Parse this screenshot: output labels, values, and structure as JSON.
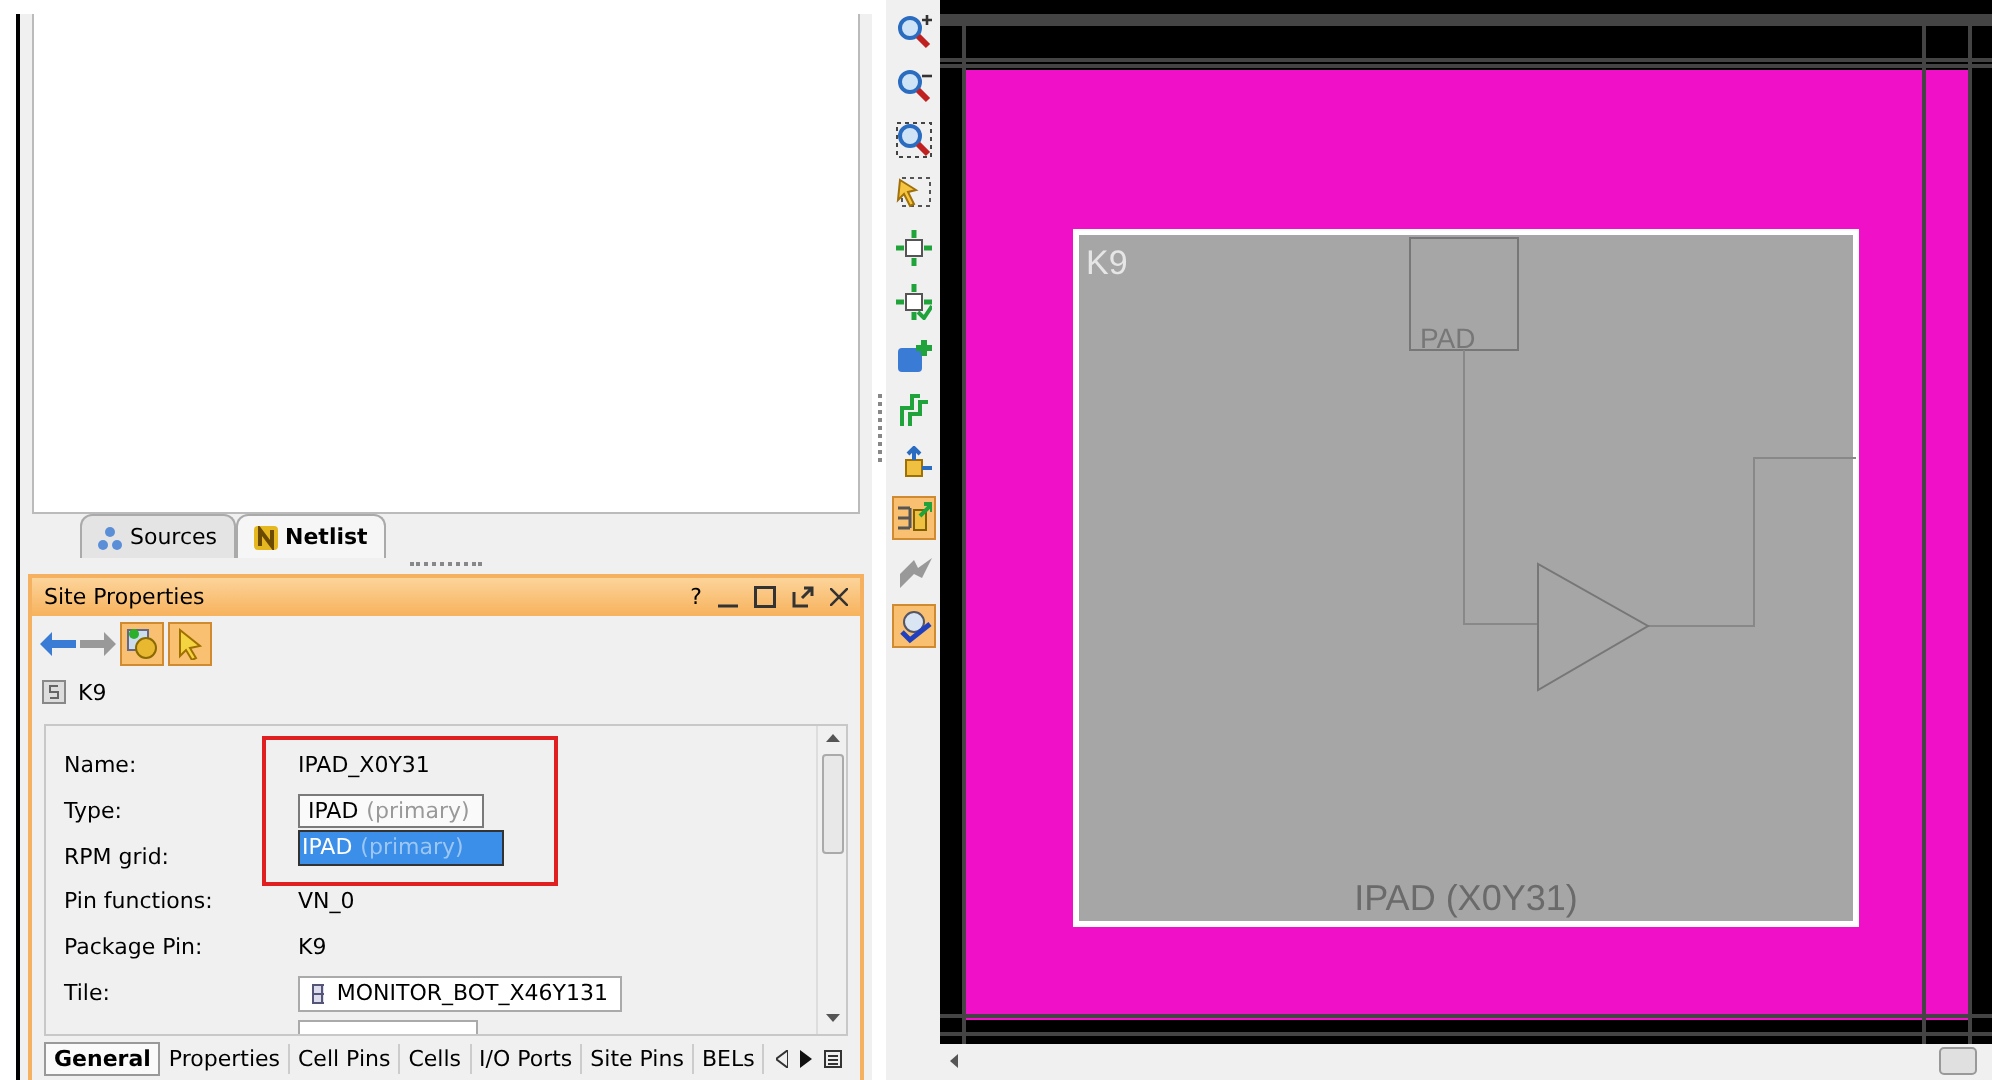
{
  "top_tabs": [
    {
      "label": "Sources",
      "kind": "sources",
      "selected": false
    },
    {
      "label": "Netlist",
      "kind": "netlist",
      "selected": true
    }
  ],
  "site_properties": {
    "title": "Site Properties",
    "help": "?",
    "object": "K9",
    "highlight": true,
    "properties": [
      {
        "label": "Name:",
        "kind": "text",
        "value": "IPAD_X0Y31"
      },
      {
        "label": "Type:",
        "kind": "dropdown",
        "value": "IPAD",
        "hint": "(primary)",
        "expanded": true,
        "options": [
          {
            "value": "IPAD",
            "hint": "(primary)",
            "selected": true
          }
        ]
      },
      {
        "label": "RPM grid:",
        "kind": "text"
      },
      {
        "label": "Pin functions:",
        "kind": "text",
        "value": "VN_0"
      },
      {
        "label": "Package Pin:",
        "kind": "text",
        "value": "K9"
      },
      {
        "label": "Tile:",
        "kind": "tile",
        "value": "MONITOR_BOT_X46Y131"
      },
      {
        "kind": "blank"
      }
    ],
    "bottom_tabs": [
      {
        "label": "General",
        "selected": true
      },
      {
        "label": "Properties",
        "selected": false
      },
      {
        "label": "Cell Pins",
        "selected": false
      },
      {
        "label": "Cells",
        "selected": false
      },
      {
        "label": "I/O Ports",
        "selected": false
      },
      {
        "label": "Site Pins",
        "selected": false
      },
      {
        "label": "BELs",
        "selected": false
      }
    ]
  },
  "toolbar": [
    {
      "kind": "zoom-in",
      "selected": false
    },
    {
      "kind": "zoom-out",
      "selected": false
    },
    {
      "kind": "zoom-fit",
      "selected": false
    },
    {
      "kind": "select-area",
      "selected": false
    },
    {
      "kind": "fit-selection",
      "selected": false
    },
    {
      "kind": "auto-fit",
      "selected": false
    },
    {
      "kind": "add-pblock",
      "selected": false
    },
    {
      "kind": "route",
      "selected": false
    },
    {
      "kind": "place",
      "selected": false
    },
    {
      "kind": "show-connections",
      "selected": true
    },
    {
      "kind": "pin",
      "selected": false
    },
    {
      "kind": "check",
      "selected": true
    }
  ],
  "device": {
    "site_label": "K9",
    "pin_label": "PAD",
    "bel_label": "IPAD (X0Y31)"
  }
}
